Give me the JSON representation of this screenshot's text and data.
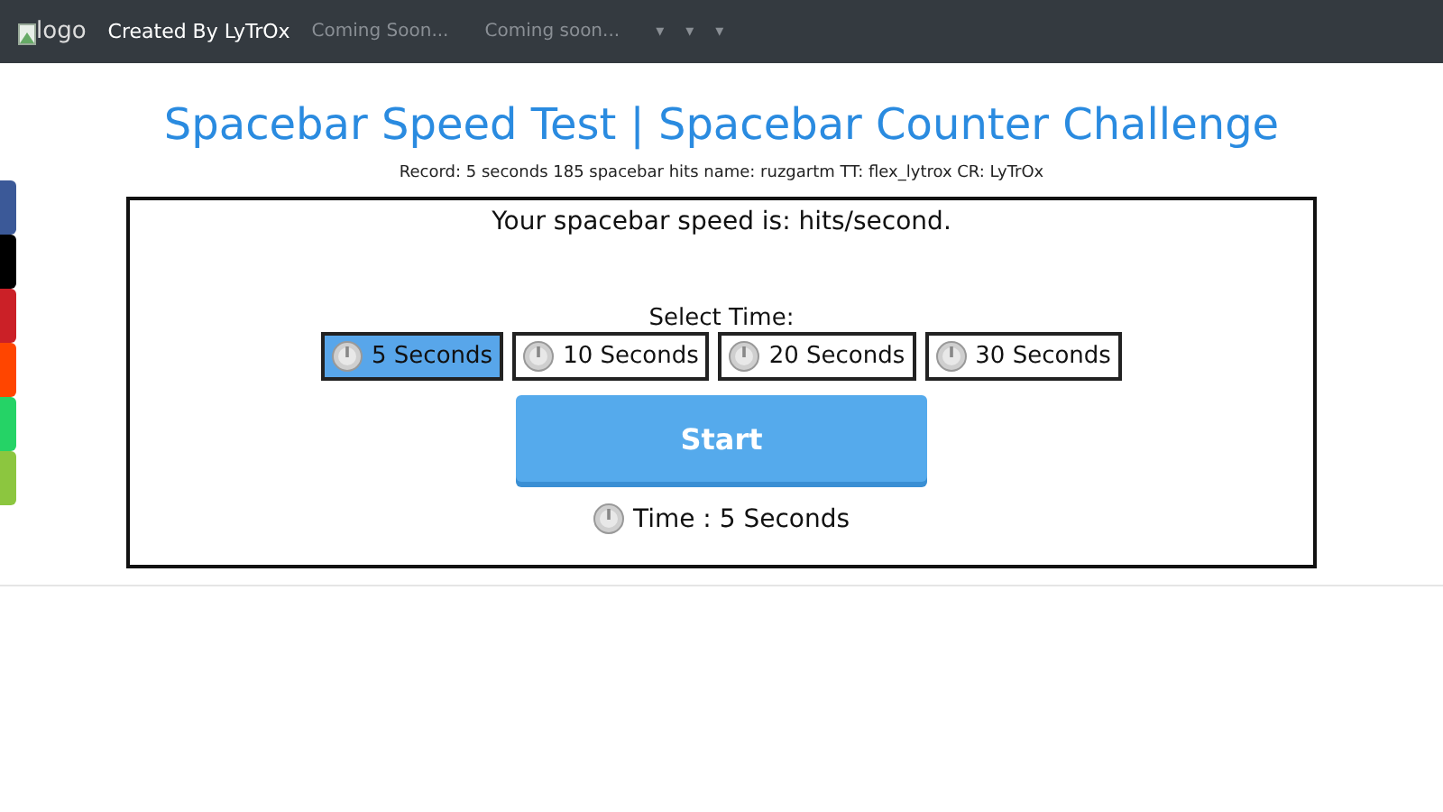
{
  "navbar": {
    "logo_alt": "logo",
    "brand": "Created By LyTrOx",
    "links": [
      "Coming Soon...",
      "Coming soon..."
    ],
    "dropdowns": [
      "▾",
      "▾",
      "▾"
    ]
  },
  "share_bar": [
    {
      "color": "#3b5998"
    },
    {
      "color": "#000000"
    },
    {
      "color": "#cb2027"
    },
    {
      "color": "#ff4500"
    },
    {
      "color": "#25d366"
    },
    {
      "color": "#8cc63f"
    }
  ],
  "title": "Spacebar Speed Test | Spacebar Counter Challenge",
  "record": "Record: 5 seconds 185 spacebar hits name: ruzgartm TT: flex_lytrox CR: LyTrOx",
  "speed_text": "Your spacebar speed is: hits/second.",
  "select_label": "Select Time:",
  "time_options": [
    {
      "label": "5 Seconds",
      "selected": true
    },
    {
      "label": "10 Seconds",
      "selected": false
    },
    {
      "label": "20 Seconds",
      "selected": false
    },
    {
      "label": "30 Seconds",
      "selected": false
    }
  ],
  "start_button": "Start",
  "time_status": "Time : 5 Seconds"
}
